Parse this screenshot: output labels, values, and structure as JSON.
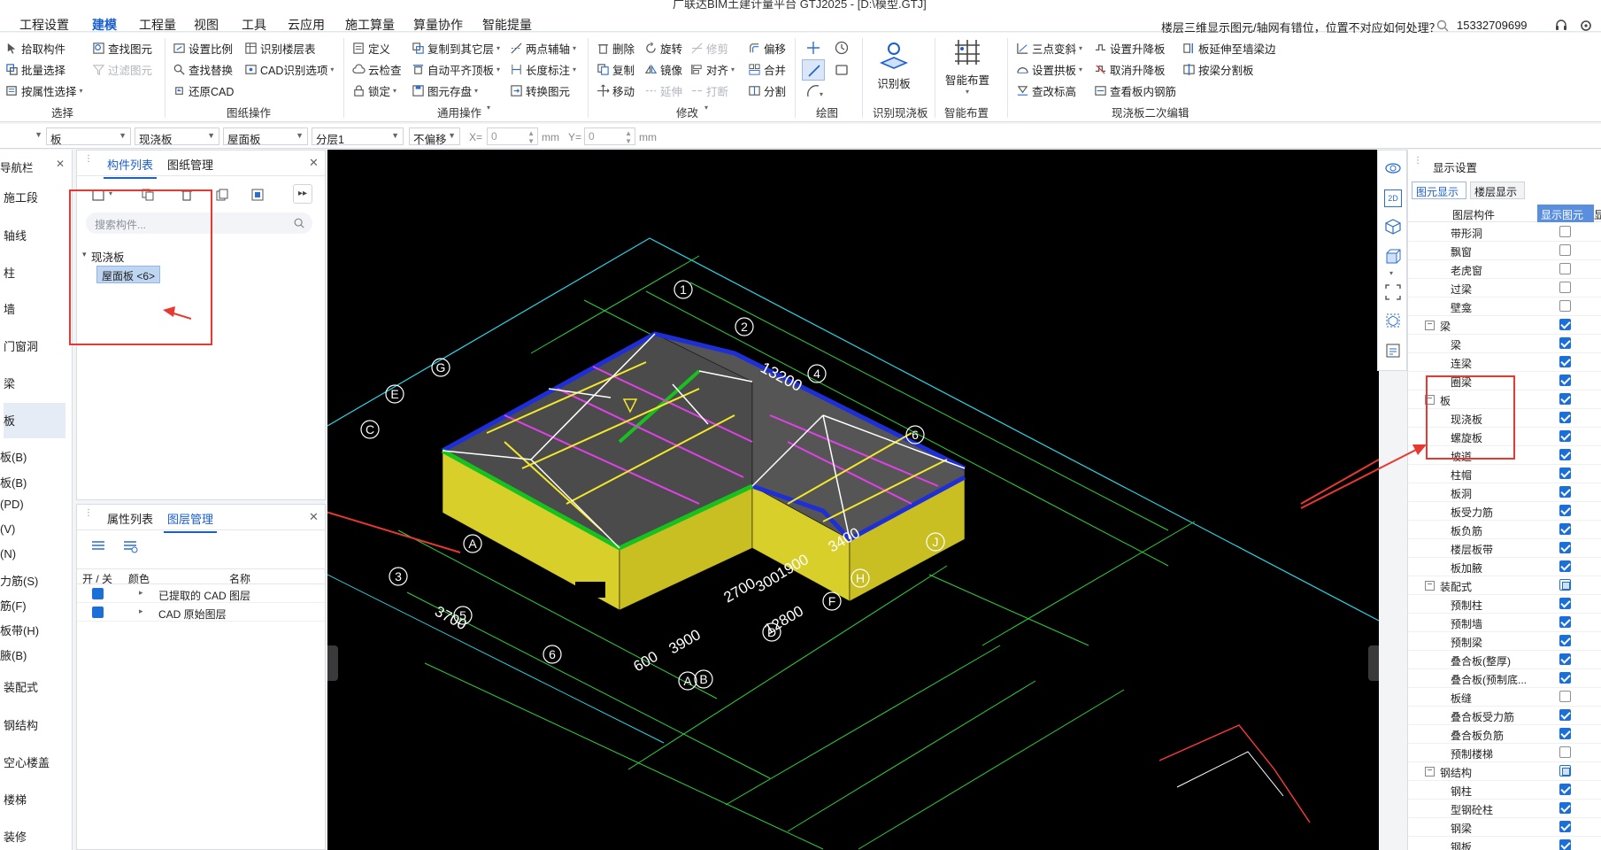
{
  "window": {
    "title": "广联达BIM土建计量平台 GTJ2025 - [D:\\模型.GTJ]"
  },
  "menu": {
    "tabs": [
      "工程设置",
      "建模",
      "工程量",
      "视图",
      "工具",
      "云应用",
      "施工算量",
      "算量协作",
      "智能提量"
    ],
    "active": "建模",
    "help_question": "楼层三维显示图元/轴网有错位，位置不对应如何处理？",
    "phone": "15332709699"
  },
  "ribbon": {
    "select": {
      "label": "选择",
      "items": [
        "拾取构件",
        "批量选择",
        "按属性选择"
      ]
    },
    "find": {
      "items": [
        "查找图元",
        "过滤图元"
      ]
    },
    "drawing_ops": {
      "label": "图纸操作",
      "items": [
        "设置比例",
        "查找替换",
        "还原CAD",
        "识别楼层表",
        "CAD识别选项"
      ]
    },
    "general_ops": {
      "label": "通用操作",
      "items": [
        "定义",
        "云检查",
        "锁定",
        "复制到其它层",
        "自动平齐顶板",
        "图元存盘",
        "两点辅轴",
        "长度标注",
        "转换图元"
      ]
    },
    "modify": {
      "label": "修改",
      "items": [
        "删除",
        "复制",
        "移动",
        "旋转",
        "镜像",
        "延伸",
        "修剪",
        "对齐",
        "打断",
        "偏移",
        "合并",
        "分割"
      ]
    },
    "draw": {
      "label": "绘图"
    },
    "identify_slab": {
      "label": "识别现浇板",
      "button": "识别板"
    },
    "smart_layout": {
      "label": "智能布置",
      "button": "智能布置"
    },
    "secondary_edit": {
      "label": "现浇板二次编辑",
      "items": [
        "三点变斜",
        "设置拱板",
        "查改标高",
        "设置升降板",
        "取消升降板",
        "查看板内钢筋",
        "板延伸至墙梁边",
        "按梁分割板"
      ]
    }
  },
  "propbar": {
    "type_select": "板",
    "sub_select": "现浇板",
    "name_select": "屋面板",
    "layer_select": "分层1",
    "offset_select": "不偏移",
    "x_label": "X=",
    "x_value": "0",
    "y_label": "Y=",
    "y_value": "0",
    "unit": "mm"
  },
  "leftnav": {
    "title": "导航栏",
    "items": [
      "施工段",
      "轴线",
      "柱",
      "墙",
      "门窗洞",
      "梁",
      "板",
      "板(B)",
      "板(B)",
      "(PD)",
      "(V)",
      "(N)",
      "力筋(S)",
      "筋(F)",
      "板带(H)",
      "腋(B)",
      "装配式",
      "钢结构",
      "空心楼盖",
      "楼梯",
      "装修"
    ]
  },
  "component_panel": {
    "tabs": [
      "构件列表",
      "图纸管理"
    ],
    "search_placeholder": "搜索构件...",
    "tree_parent": "现浇板",
    "tree_child": "屋面板 <6>"
  },
  "layer_panel": {
    "tabs": [
      "属性列表",
      "图层管理"
    ],
    "columns": [
      "开 / 关",
      "颜色",
      "名称"
    ],
    "rows": [
      "已提取的 CAD 图层",
      "CAD 原始图层"
    ]
  },
  "viewport": {
    "dims": [
      "13200",
      "3700",
      "2700",
      "3900",
      "600",
      "12800",
      "1900",
      "3400",
      "300"
    ],
    "axis_labels": [
      "1",
      "2",
      "4",
      "6",
      "G",
      "E",
      "A",
      "J",
      "H",
      "D",
      "F",
      "B",
      "A",
      "3",
      "5",
      "6",
      "C"
    ]
  },
  "display_settings": {
    "title": "显示设置",
    "tabs": [
      "图元显示",
      "楼层显示"
    ],
    "columns": [
      "图层构件",
      "显示图元",
      "显"
    ],
    "rows": [
      {
        "name": "带形洞",
        "level": 2,
        "check": "off"
      },
      {
        "name": "飘窗",
        "level": 2,
        "check": "off"
      },
      {
        "name": "老虎窗",
        "level": 2,
        "check": "off"
      },
      {
        "name": "过梁",
        "level": 2,
        "check": "off"
      },
      {
        "name": "壁龛",
        "level": 2,
        "check": "off"
      },
      {
        "name": "梁",
        "level": 1,
        "check": "on"
      },
      {
        "name": "梁",
        "level": 2,
        "check": "on"
      },
      {
        "name": "连梁",
        "level": 2,
        "check": "on"
      },
      {
        "name": "圈梁",
        "level": 2,
        "check": "on"
      },
      {
        "name": "板",
        "level": 1,
        "check": "on"
      },
      {
        "name": "现浇板",
        "level": 2,
        "check": "on"
      },
      {
        "name": "螺旋板",
        "level": 2,
        "check": "on"
      },
      {
        "name": "坡道",
        "level": 2,
        "check": "on"
      },
      {
        "name": "柱帽",
        "level": 2,
        "check": "on"
      },
      {
        "name": "板洞",
        "level": 2,
        "check": "on"
      },
      {
        "name": "板受力筋",
        "level": 2,
        "check": "on"
      },
      {
        "name": "板负筋",
        "level": 2,
        "check": "on"
      },
      {
        "name": "楼层板带",
        "level": 2,
        "check": "on"
      },
      {
        "name": "板加腋",
        "level": 2,
        "check": "on"
      },
      {
        "name": "装配式",
        "level": 1,
        "check": "part"
      },
      {
        "name": "预制柱",
        "level": 2,
        "check": "on"
      },
      {
        "name": "预制墙",
        "level": 2,
        "check": "on"
      },
      {
        "name": "预制梁",
        "level": 2,
        "check": "on"
      },
      {
        "name": "叠合板(整厚)",
        "level": 2,
        "check": "on"
      },
      {
        "name": "叠合板(预制底...",
        "level": 2,
        "check": "on"
      },
      {
        "name": "板缝",
        "level": 2,
        "check": "off"
      },
      {
        "name": "叠合板受力筋",
        "level": 2,
        "check": "on"
      },
      {
        "name": "叠合板负筋",
        "level": 2,
        "check": "on"
      },
      {
        "name": "预制楼梯",
        "level": 2,
        "check": "off"
      },
      {
        "name": "钢结构",
        "level": 1,
        "check": "part"
      },
      {
        "name": "钢柱",
        "level": 2,
        "check": "on"
      },
      {
        "name": "型钢砼柱",
        "level": 2,
        "check": "on"
      },
      {
        "name": "钢梁",
        "level": 2,
        "check": "on"
      },
      {
        "name": "钢板",
        "level": 2,
        "check": "on"
      }
    ]
  },
  "colors": {
    "accent": "#1a5fd0",
    "annotation": "#e8382f",
    "slab_top": "#4b4b4b",
    "slab_side": "#e2d62c",
    "beam_blue": "#1f2fd8",
    "beam_green": "#18c21e"
  }
}
